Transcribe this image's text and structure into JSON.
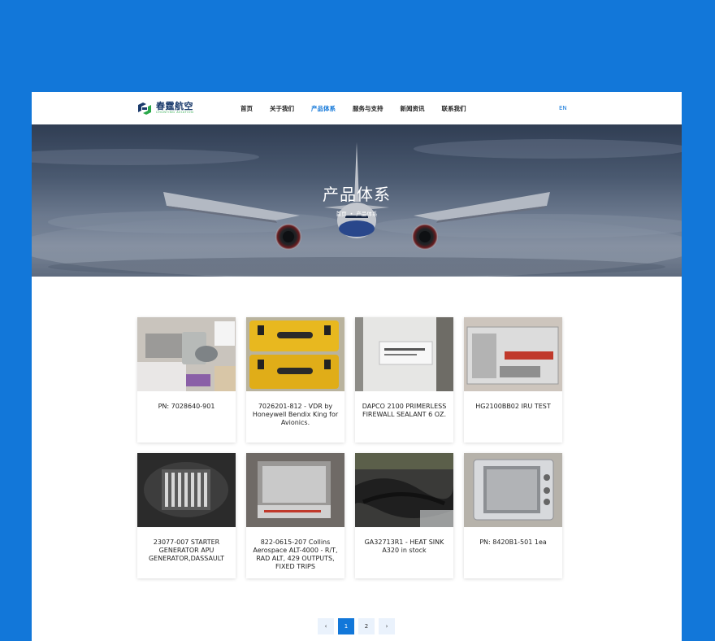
{
  "brand": {
    "name_cn": "春霆航空",
    "name_en": "CHUNTING AVIATION"
  },
  "nav": {
    "items": [
      "首页",
      "关于我们",
      "产品体系",
      "服务与支持",
      "新闻资讯",
      "联系我们"
    ],
    "active_index": 2,
    "lang": "EN"
  },
  "banner": {
    "title": "产品体系",
    "breadcrumb": {
      "home": "首页",
      "separator": "•",
      "current": "产品体系"
    }
  },
  "products": [
    {
      "caption": "PN: 7028640-901"
    },
    {
      "caption": "7026201-812 - VDR by Honeywell Bendix King for Avionics."
    },
    {
      "caption": "DAPCO 2100 PRIMERLESS FIREWALL SEALANT 6 OZ."
    },
    {
      "caption": "HG2100BB02 IRU TEST"
    },
    {
      "caption": "23077-007 STARTER GENERATOR APU GENERATOR,DASSAULT"
    },
    {
      "caption": "822-0615-207 Collins Aerospace ALT-4000 - R/T, RAD ALT, 429 OUTPUTS, FIXED TRIPS"
    },
    {
      "caption": "GA32713R1 - HEAT SINK A320 in stock"
    },
    {
      "caption": "PN: 8420B1-501 1ea"
    }
  ],
  "pagination": {
    "prev": "‹",
    "pages": [
      "1",
      "2"
    ],
    "current": "1",
    "next": "›"
  },
  "colors": {
    "accent": "#1277d9",
    "frame": "#1277d9",
    "logo_dark": "#1a3a6b",
    "logo_green": "#2aa84a"
  }
}
